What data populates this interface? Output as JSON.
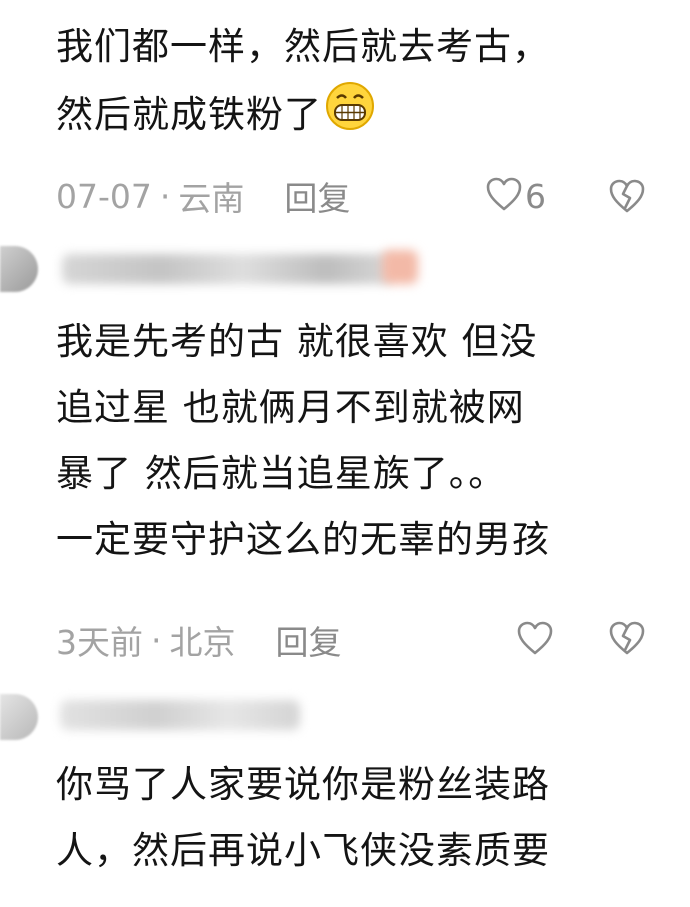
{
  "comments": [
    {
      "lines": [
        "我们都一样，然后就去考古，",
        "然后就成铁粉了"
      ],
      "date": "07-07",
      "separator": "·",
      "location": "云南",
      "reply_label": "回复",
      "like_count": "6"
    },
    {
      "lines": [
        "我是先考的古 就很喜欢 但没",
        "追过星  也就俩月不到就被网",
        "暴了  然后就当追星族了。。",
        "一定要守护这么的无辜的男孩"
      ],
      "date": "3天前",
      "separator": "·",
      "location": "北京",
      "reply_label": "回复",
      "like_count": ""
    },
    {
      "lines": [
        "你骂了人家要说你是粉丝装路",
        "人，然后再说小飞侠没素质要"
      ]
    }
  ],
  "colors": {
    "text": "#141414",
    "meta": "#a3a3a3",
    "action": "#8a8a8a"
  },
  "icons": {
    "emoji": "grinning-face-icon",
    "like": "heart-outline-icon",
    "dislike": "broken-heart-icon"
  }
}
